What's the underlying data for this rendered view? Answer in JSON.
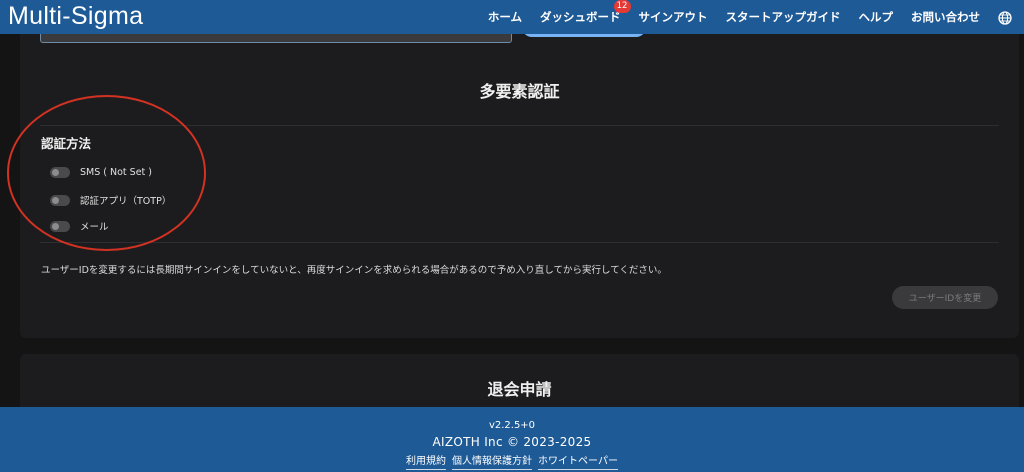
{
  "app": {
    "brand": "Multi-Sigma"
  },
  "nav": {
    "items": [
      {
        "label": "ホーム"
      },
      {
        "label": "ダッシュボード",
        "badge": "12"
      },
      {
        "label": "サインアウト"
      },
      {
        "label": "スタートアップガイド"
      },
      {
        "label": "ヘルプ"
      },
      {
        "label": "お問い合わせ"
      }
    ],
    "globe_icon": "globe-icon"
  },
  "mfa": {
    "title": "多要素認証",
    "methods_heading": "認証方法",
    "methods": [
      {
        "label": "SMS ( Not Set )",
        "enabled": false
      },
      {
        "label": "認証アプリ（TOTP）",
        "enabled": false
      },
      {
        "label": "メール",
        "enabled": false
      }
    ],
    "note": "ユーザーIDを変更するには長期間サインインをしていないと、再度サインインを求められる場合があるので予め入り直してから実行してください。",
    "change_button": "ユーザーIDを変更"
  },
  "withdraw": {
    "title": "退会申請"
  },
  "footer": {
    "version": "v2.2.5+0",
    "copyright": "AIZOTH Inc © 2023-2025",
    "links": [
      {
        "label": "利用規約"
      },
      {
        "label": "個人情報保護方針"
      },
      {
        "label": "ホワイトペーパー"
      }
    ]
  },
  "colors": {
    "nav_bg": "#1e5a96",
    "page_bg": "#141414",
    "card_bg": "#1c1c1e",
    "badge": "#e53935",
    "annotation_circle": "#d23222"
  }
}
